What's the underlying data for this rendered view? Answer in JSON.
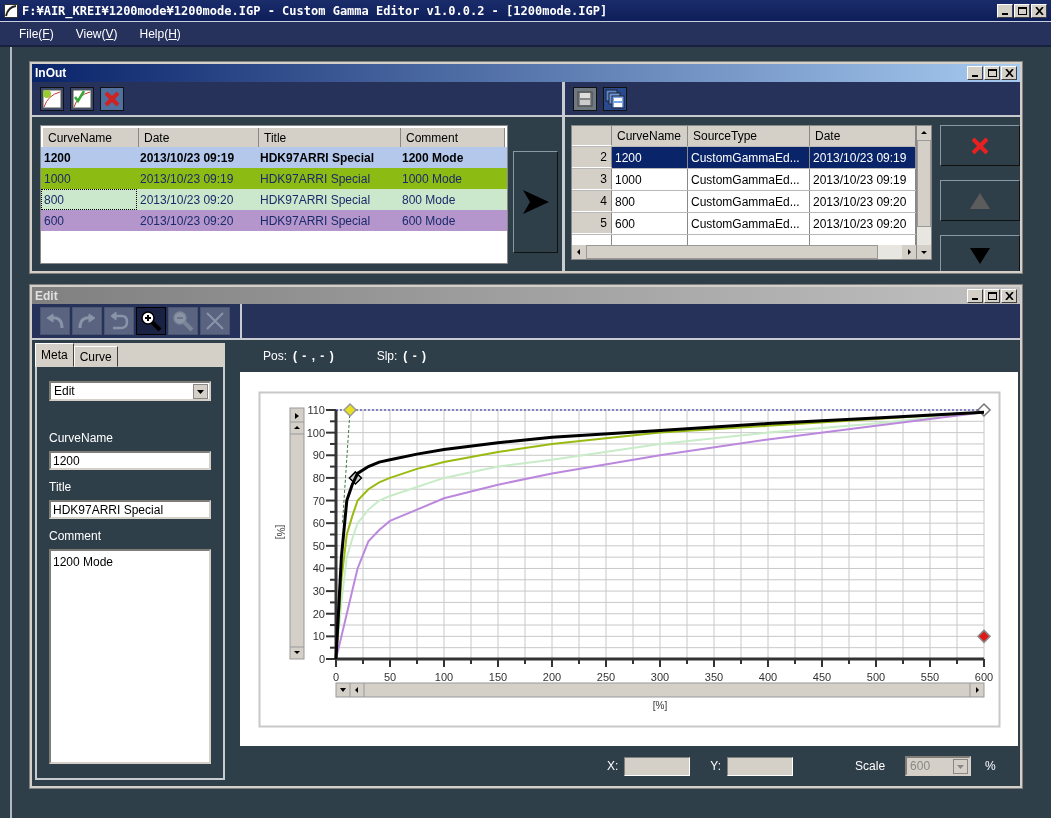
{
  "window": {
    "title": "F:¥AIR_KREI¥1200mode¥1200mode.IGP - Custom Gamma Editor v1.0.0.2 - [1200mode.IGP]"
  },
  "menu": [
    {
      "before": "File(",
      "key": "F",
      "after": ")"
    },
    {
      "before": "View(",
      "key": "V",
      "after": ")"
    },
    {
      "before": "Help(",
      "key": "H",
      "after": ")"
    }
  ],
  "inout": {
    "title": "InOut",
    "curve_table": {
      "columns": [
        "CurveName",
        "Date",
        "Title",
        "Comment"
      ],
      "rows": [
        {
          "cells": [
            "1200",
            "2013/10/23 09:19",
            "HDK97ARRI Special",
            "1200 Mode"
          ],
          "color": "#b4c8ec",
          "selected": true,
          "focused": false
        },
        {
          "cells": [
            "1000",
            "2013/10/23 09:19",
            "HDK97ARRI Special",
            "1000 Mode"
          ],
          "color": "#8cbc14",
          "selected": false,
          "focused": false
        },
        {
          "cells": [
            "800",
            "2013/10/23 09:20",
            "HDK97ARRI Special",
            "800 Mode"
          ],
          "color": "#cce8cc",
          "selected": false,
          "focused": true
        },
        {
          "cells": [
            "600",
            "2013/10/23 09:20",
            "HDK97ARRI Special",
            "600 Mode"
          ],
          "color": "#b496cc",
          "selected": false,
          "focused": false
        }
      ]
    },
    "source_table": {
      "columns": [
        "CurveName",
        "SourceType",
        "Date"
      ],
      "rows": [
        {
          "index": "2",
          "cells": [
            "1200",
            "CustomGammaEd...",
            "2013/10/23 09:19"
          ],
          "selected": true
        },
        {
          "index": "3",
          "cells": [
            "1000",
            "CustomGammaEd...",
            "2013/10/23 09:19"
          ],
          "selected": false
        },
        {
          "index": "4",
          "cells": [
            "800",
            "CustomGammaEd...",
            "2013/10/23 09:20"
          ],
          "selected": false
        },
        {
          "index": "5",
          "cells": [
            "600",
            "CustomGammaEd...",
            "2013/10/23 09:20"
          ],
          "selected": false
        }
      ]
    },
    "side_buttons": [
      {
        "kind": "delete",
        "disabled": false
      },
      {
        "kind": "up",
        "disabled": true
      },
      {
        "kind": "down",
        "disabled": false
      }
    ]
  },
  "edit": {
    "title": "Edit",
    "toolbar": [
      {
        "kind": "undo",
        "disabled": true
      },
      {
        "kind": "redo",
        "disabled": true
      },
      {
        "kind": "revert",
        "disabled": true
      },
      {
        "kind": "zoom_in",
        "disabled": false
      },
      {
        "kind": "zoom_out",
        "disabled": true
      },
      {
        "kind": "clear",
        "disabled": true
      }
    ],
    "tabs": [
      {
        "label": "Meta",
        "selected": true
      },
      {
        "label": "Curve",
        "selected": false
      }
    ],
    "mode_select": "Edit",
    "fields": [
      {
        "label": "CurveName",
        "value": "1200",
        "kind": "input"
      },
      {
        "label": "Title",
        "value": "HDK97ARRI Special",
        "kind": "input"
      },
      {
        "label": "Comment",
        "value": "1200 Mode",
        "kind": "textarea"
      }
    ],
    "pos_label": "Pos:",
    "pos_value": "( - , - )",
    "slp_label": "Slp:",
    "slp_value": "( - )",
    "chart_data": {
      "type": "line",
      "grid": true,
      "xlabel": "[%]",
      "ylabel": "[%]",
      "xlim": [
        0,
        600
      ],
      "ylim": [
        0,
        110
      ],
      "x": [
        0,
        5,
        10,
        15,
        20,
        30,
        40,
        50,
        75,
        100,
        150,
        200,
        300,
        400,
        500,
        600
      ],
      "series": [
        {
          "color": "#c8ecc8",
          "values": [
            0,
            25,
            45,
            53,
            60,
            66,
            70,
            72,
            76,
            80,
            85,
            88,
            95,
            100,
            104,
            109
          ]
        },
        {
          "color": "#bb88dd",
          "values": [
            0,
            10,
            20,
            30,
            40,
            52,
            57,
            61,
            66,
            71,
            77,
            82,
            90,
            97,
            103,
            109
          ]
        },
        {
          "color": "#99bb11",
          "values": [
            0,
            35,
            55,
            63,
            70,
            75,
            78,
            80,
            84,
            87,
            91.5,
            95,
            100,
            103,
            106,
            109
          ]
        },
        {
          "color": "#000000",
          "values": [
            0,
            45,
            70,
            77,
            82,
            85,
            87,
            88,
            90.5,
            92.5,
            95.5,
            98,
            101,
            104,
            106.5,
            109
          ]
        }
      ],
      "xticks": [
        0,
        50,
        100,
        150,
        200,
        250,
        300,
        350,
        400,
        450,
        500,
        550,
        600
      ],
      "yticks": [
        0,
        10,
        20,
        30,
        40,
        50,
        60,
        70,
        80,
        90,
        100,
        110
      ]
    },
    "x_label": "X:",
    "y_label": "Y:",
    "scale_label": "Scale",
    "scale_value": "600",
    "scale_disabled": true,
    "unit": "%"
  }
}
